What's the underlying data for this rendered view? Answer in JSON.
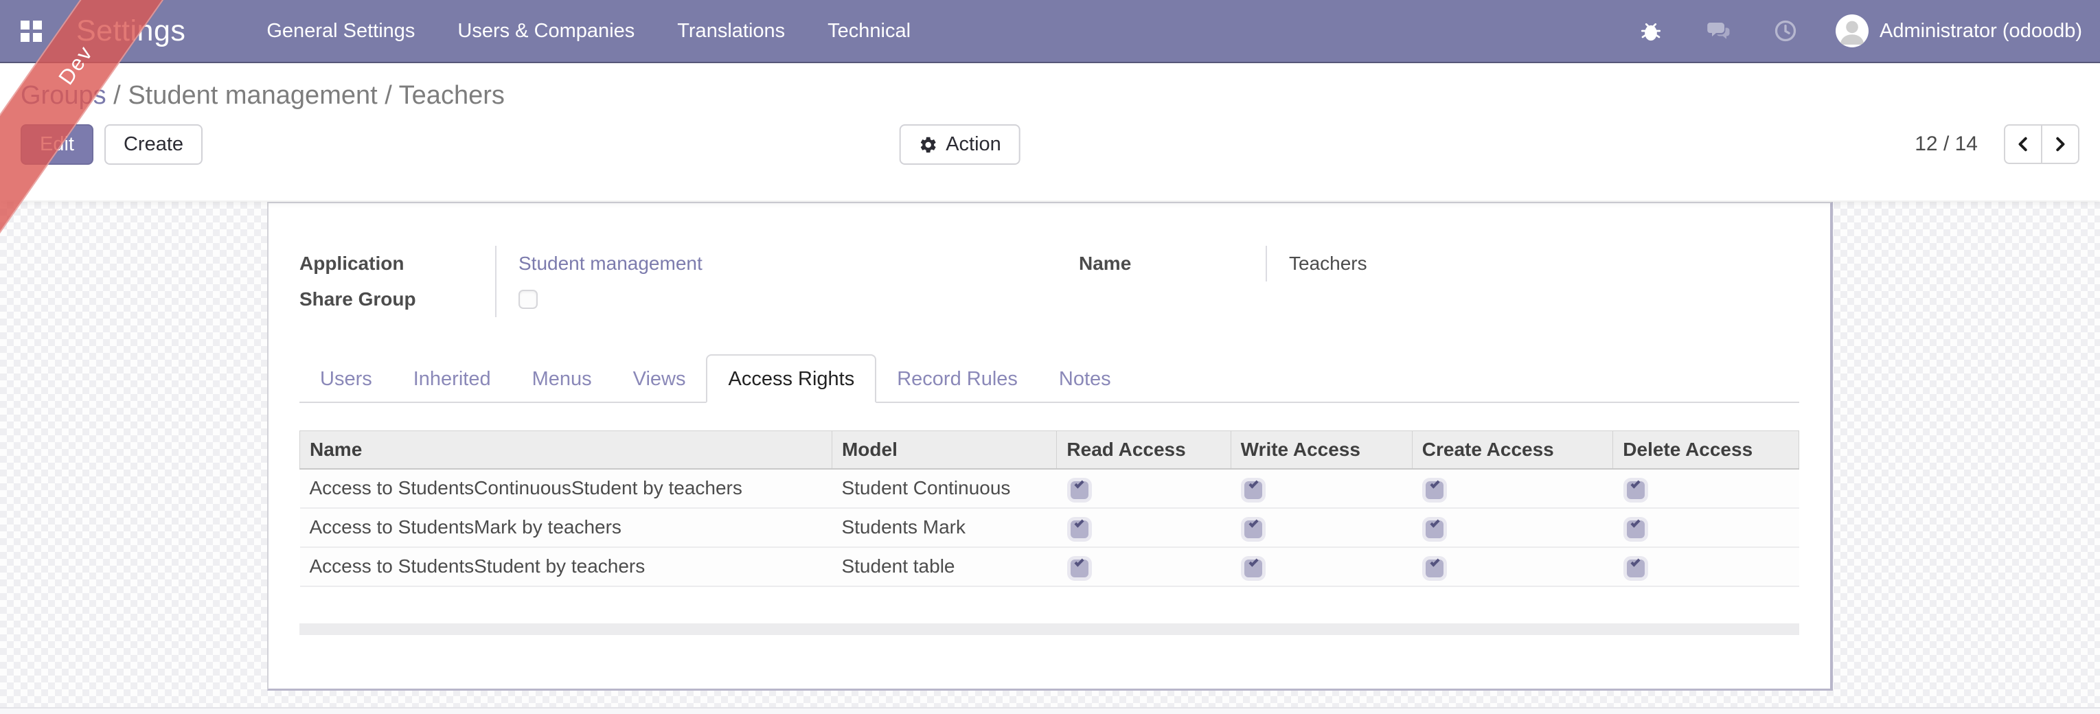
{
  "topbar": {
    "title": "Settings",
    "menu_items": [
      "General Settings",
      "Users & Companies",
      "Translations",
      "Technical"
    ],
    "user_name": "Administrator (odoodb)"
  },
  "ribbon": {
    "label": "Dev"
  },
  "control_panel": {
    "breadcrumb": [
      {
        "label": "Groups",
        "link": true
      },
      {
        "label": "Student management",
        "link": false
      },
      {
        "label": "Teachers",
        "link": false
      }
    ],
    "edit_label": "Edit",
    "create_label": "Create",
    "action_label": "Action",
    "pager_value": "12 / 14"
  },
  "form": {
    "left_fields": [
      {
        "label": "Application",
        "value": "Student management",
        "kind": "link"
      },
      {
        "label": "Share Group",
        "kind": "checkbox",
        "checked": false
      }
    ],
    "right_fields": [
      {
        "label": "Name",
        "value": "Teachers",
        "kind": "text"
      }
    ],
    "tabs": [
      {
        "label": "Users",
        "active": false
      },
      {
        "label": "Inherited",
        "active": false
      },
      {
        "label": "Menus",
        "active": false
      },
      {
        "label": "Views",
        "active": false
      },
      {
        "label": "Access Rights",
        "active": true
      },
      {
        "label": "Record Rules",
        "active": false
      },
      {
        "label": "Notes",
        "active": false
      }
    ],
    "access_table": {
      "columns": [
        "Name",
        "Model",
        "Read Access",
        "Write Access",
        "Create Access",
        "Delete Access"
      ],
      "rows": [
        {
          "name": "Access to StudentsContinuousStudent by teachers",
          "model": "Student Continuous",
          "read": true,
          "write": true,
          "create": true,
          "delete": true
        },
        {
          "name": "Access to StudentsMark by teachers",
          "model": "Students Mark",
          "read": true,
          "write": true,
          "create": true,
          "delete": true
        },
        {
          "name": "Access to StudentsStudent by teachers",
          "model": "Student table",
          "read": true,
          "write": true,
          "create": true,
          "delete": true
        }
      ]
    }
  },
  "colors": {
    "navbar": "#7b7ca8",
    "accent": "#7c7bad",
    "ribbon": "rgba(219,88,82,0.8)",
    "table_header_bg": "#ededed",
    "checkbox_checked_bg": "#b3b1cb",
    "checkbox_tick": "#55537f"
  }
}
